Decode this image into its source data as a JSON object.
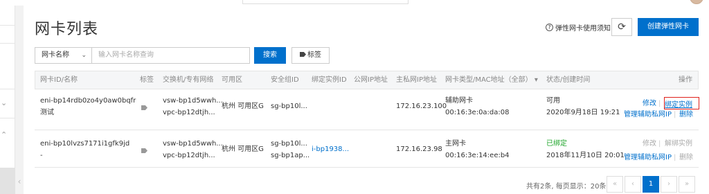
{
  "page": {
    "title": "网卡列表",
    "help_link": "弹性网卡使用须知",
    "help_icon": "question-circle-icon",
    "refresh_icon": "refresh-icon",
    "create_button": "创建弹性网卡"
  },
  "filter": {
    "select_value": "网卡名称",
    "search_placeholder": "输入网卡名称查询",
    "search_button": "搜索",
    "tag_button": "标签"
  },
  "table": {
    "columns": [
      "网卡ID/名称",
      "标签",
      "交换机/专有网络",
      "可用区",
      "安全组ID",
      "绑定实例ID",
      "公网IP地址",
      "主私网IP地址",
      "网卡类型/MAC地址（全部）",
      "状态/创建时间",
      "操作"
    ],
    "rows": [
      {
        "id": "eni-bp14rdb0zo4y0aw0bqfr",
        "name": "测试",
        "vswitch": "vsw-bp1d5wwh...",
        "vpc": "vpc-bp12dtjh...",
        "zone": "杭州 可用区G",
        "sg1": "sg-bp10l...",
        "sg2": "",
        "instance": "",
        "public_ip": "",
        "private_ip": "172.16.23.100",
        "type": "辅助网卡",
        "mac": "00:16:3e:0a:da:08",
        "status": "可用",
        "created": "2020年9月18日 19:21",
        "op_modify": "修改",
        "op_bind": "绑定实例",
        "op_manage": "管理辅助私网IP",
        "op_delete": "删除"
      },
      {
        "id": "eni-bp10lvzs7171i1gfk9jd",
        "name": "-",
        "vswitch": "vsw-bp1d5wwh...",
        "vpc": "vpc-bp12dtjh...",
        "zone": "杭州 可用区G",
        "sg1": "sg-bp10l...",
        "sg2": "sg-bp1ap...",
        "instance": "i-bp1938...",
        "public_ip": "",
        "private_ip": "172.16.23.98",
        "type": "主网卡",
        "mac": "00:16:3e:14:ee:b4",
        "status": "已绑定",
        "created": "2018年11月10日 20:01",
        "op_modify": "修改",
        "op_bind": "解绑实例",
        "op_manage": "管理辅助私网IP",
        "op_delete": "删除"
      }
    ]
  },
  "pagination": {
    "summary": "共有2条, 每页显示：20条",
    "first": "«",
    "prev": "‹",
    "current": "1",
    "next": "›",
    "last": "»"
  },
  "colors": {
    "primary": "#0070cc",
    "success": "#1fa52b",
    "highlight": "#e0201b"
  }
}
